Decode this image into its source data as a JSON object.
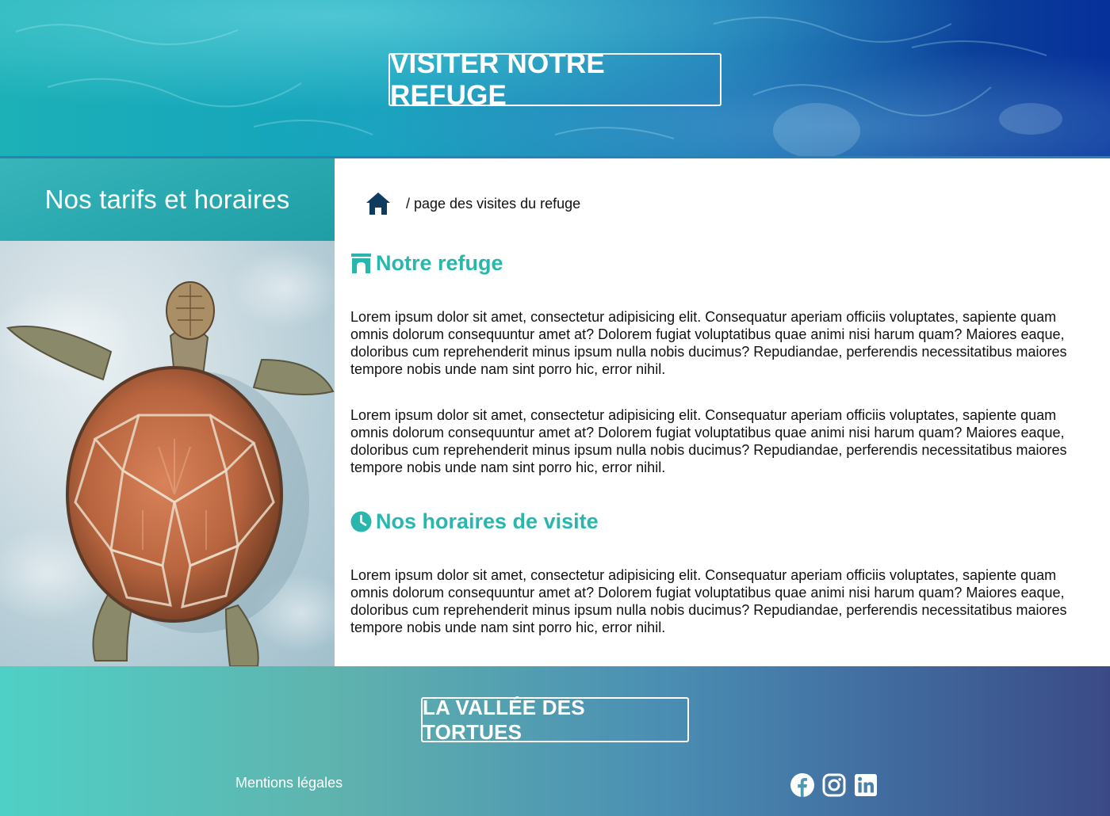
{
  "header": {
    "title": "VISITER NOTRE REFUGE"
  },
  "sidebar": {
    "heading": "Nos tarifs et horaires",
    "image_subject": "sea-turtle"
  },
  "breadcrumb": {
    "home_icon": "home-icon",
    "current": "/ page des visites du refuge"
  },
  "sections": [
    {
      "icon": "archway-icon",
      "title": "Notre refuge",
      "paragraphs": [
        "Lorem ipsum dolor sit amet, consectetur adipisicing elit. Consequatur aperiam officiis voluptates, sapiente quam omnis dolorum consequuntur amet at? Dolorem fugiat voluptatibus quae animi nisi harum quam? Maiores eaque, doloribus cum reprehenderit minus ipsum nulla nobis ducimus? Repudiandae, perferendis necessitatibus maiores tempore nobis unde nam sint porro hic, error nihil.",
        "Lorem ipsum dolor sit amet, consectetur adipisicing elit. Consequatur aperiam officiis voluptates, sapiente quam omnis dolorum consequuntur amet at? Dolorem fugiat voluptatibus quae animi nisi harum quam? Maiores eaque, doloribus cum reprehenderit minus ipsum nulla nobis ducimus? Repudiandae, perferendis necessitatibus maiores tempore nobis unde nam sint porro hic, error nihil."
      ]
    },
    {
      "icon": "clock-icon",
      "title": "Nos horaires de visite",
      "paragraphs": [
        "Lorem ipsum dolor sit amet, consectetur adipisicing elit. Consequatur aperiam officiis voluptates, sapiente quam omnis dolorum consequuntur amet at? Dolorem fugiat voluptatibus quae animi nisi harum quam? Maiores eaque, doloribus cum reprehenderit minus ipsum nulla nobis ducimus? Repudiandae, perferendis necessitatibus maiores tempore nobis unde nam sint porro hic, error nihil."
      ]
    }
  ],
  "footer": {
    "brand": "LA VALLÉE DES TORTUES",
    "legal_link": "Mentions légales",
    "social_icons": [
      "facebook-icon",
      "instagram-icon",
      "linkedin-icon"
    ]
  },
  "colors": {
    "accent": "#29b7ad",
    "home_icon": "#0f3b5e",
    "text": "#111111",
    "white": "#ffffff"
  }
}
